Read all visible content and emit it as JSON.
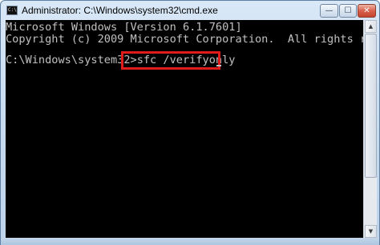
{
  "window": {
    "title": "Administrator: C:\\Windows\\system32\\cmd.exe",
    "icon": "cmd-icon",
    "icon_glyph": "C:\\",
    "controls": {
      "minimize": "—",
      "maximize": "☐",
      "close": "✕"
    }
  },
  "console": {
    "lines": [
      "Microsoft Windows [Version 6.1.7601]",
      "Copyright (c) 2009 Microsoft Corporation.  All rights reserved."
    ],
    "prompt": "C:\\Windows\\system32>",
    "command": "sfc /verifyonly",
    "highlight_color": "#e01b1b",
    "text_color": "#c0c0c0",
    "background": "#000000"
  },
  "scrollbar": {
    "up_arrow": "▲",
    "down_arrow": "▼"
  }
}
